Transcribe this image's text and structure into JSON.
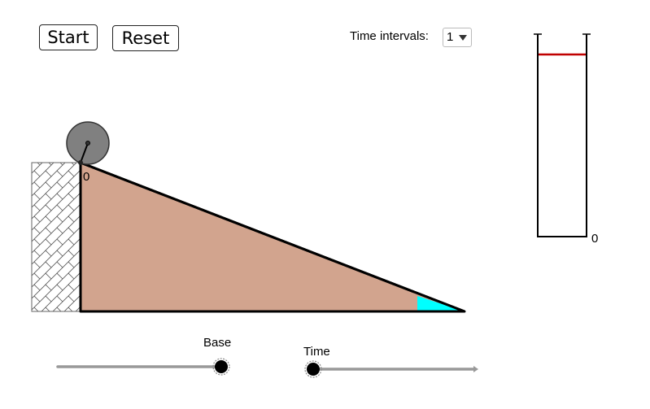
{
  "controls": {
    "start_label": "Start",
    "reset_label": "Reset",
    "time_intervals_label": "Time intervals:",
    "time_intervals_value": "1"
  },
  "scene": {
    "incline_origin_label": "0",
    "tube_zero_label": "0",
    "colors": {
      "ramp_fill": "#d2a48e",
      "angle_marker": "#00ffff",
      "ball_fill": "#808080",
      "level_line": "#c00000",
      "wall_hatch": "#555555"
    }
  },
  "sliders": {
    "base_label": "Base",
    "time_label": "Time",
    "base_value_fraction": 1.0,
    "time_value_fraction": 0.0
  }
}
